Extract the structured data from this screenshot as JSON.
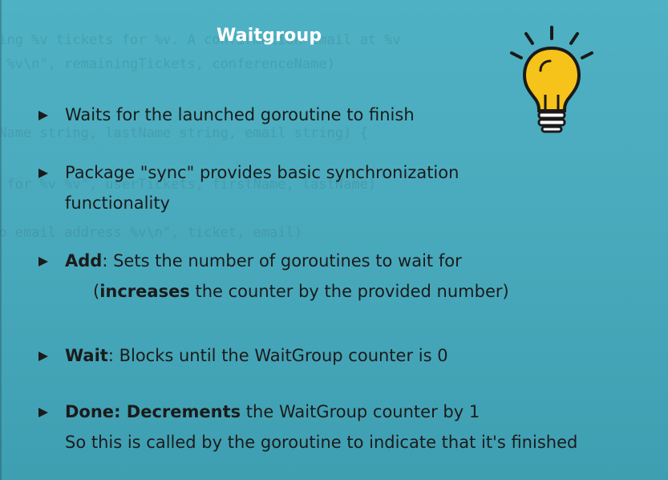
{
  "background_code": [
    "eing %v tickets for %v. A confirmation email at %v",
    "r %v\\n\", remainingTickets, conferenceName)",
    "tName string, lastName string, email string) {",
    "s for %v %v\", userTickets, firstName, lastName)",
    "to email address %v\\n\", ticket, email)"
  ],
  "slide": {
    "title": "Waitgroup",
    "bullets": [
      {
        "lines": [
          "Waits for the launched goroutine to finish"
        ]
      },
      {
        "lines": [
          "Package \"sync\" provides basic synchronization",
          "functionality"
        ]
      },
      {
        "bold": "Add",
        "rest": ": Sets the number of goroutines to wait for",
        "line2_open": "(",
        "line2_bold": "increases",
        "line2_rest": " the counter by the provided number)"
      },
      {
        "bold": "Wait",
        "rest": ": Blocks until the WaitGroup counter is 0"
      },
      {
        "bold": "Done",
        "mid": ": ",
        "bold2": "Decrements",
        "rest": " the WaitGroup counter by 1",
        "line2": "So this is called by the goroutine to indicate that it's finished"
      }
    ]
  },
  "colors": {
    "background": "#4aaabd",
    "title": "#ffffff",
    "text": "#1b1b1b",
    "bulb": "#f6c31b"
  },
  "icon": "lightbulb-icon"
}
